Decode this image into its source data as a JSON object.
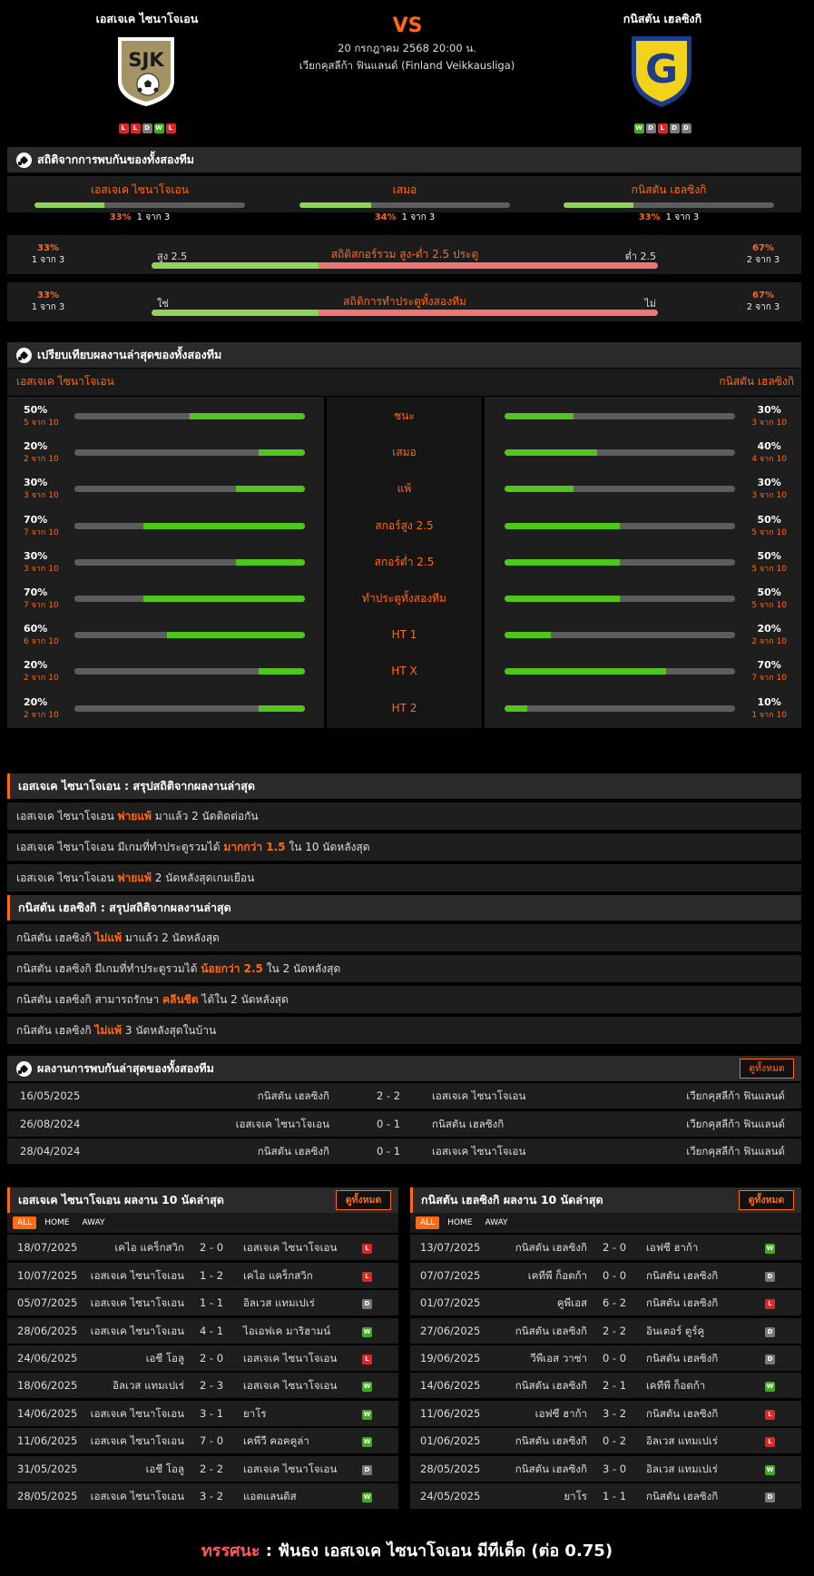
{
  "header": {
    "vs": "VS",
    "home": {
      "name": "เอสเจเค ไซนาโจเอน",
      "logo_text": "SJK",
      "form": [
        "L",
        "L",
        "D",
        "W",
        "L"
      ]
    },
    "away": {
      "name": "กนิสตัน เฮลซิงกิ",
      "logo_text": "G",
      "form": [
        "W",
        "D",
        "L",
        "D",
        "D"
      ]
    },
    "datetime": "20 กรกฎาคม 2568 20:00 น.",
    "league": "เวียกคุสลีก้า ฟินแลนด์ (Finland Veikkausliga)"
  },
  "h2h_stats": {
    "title": "สถิติจากการพบกันของทั้งสองทีม",
    "cols": [
      {
        "label": "เอสเจเค ไซนาโจเอน",
        "pct": "33%",
        "sub": "1 จาก 3",
        "frac": 0.33
      },
      {
        "label": "เสมอ",
        "pct": "34%",
        "sub": "1 จาก 3",
        "frac": 0.34
      },
      {
        "label": "กนิสตัน เฮลซิงกิ",
        "pct": "33%",
        "sub": "1 จาก 3",
        "frac": 0.33
      }
    ],
    "ou": {
      "title": "สถิติสกอร์รวม สูง-ต่ำ 2.5 ประตู",
      "left_label": "สูง 2.5",
      "right_label": "ต่ำ 2.5",
      "left_pct": "33%",
      "left_sub": "1 จาก 3",
      "right_pct": "67%",
      "right_sub": "2 จาก 3",
      "frac": 0.33
    },
    "btts": {
      "title": "สถิติการทำประตูทั้งสองทีม",
      "left_label": "ใช่",
      "right_label": "ไม่",
      "left_pct": "33%",
      "left_sub": "1 จาก 3",
      "right_pct": "67%",
      "right_sub": "2 จาก 3",
      "frac": 0.33
    }
  },
  "compare": {
    "title": "เปรียบเทียบผลงานล่าสุดของทั้งสองทีม",
    "home": "เอสเจเค ไซนาโจเอน",
    "away": "กนิสตัน เฮลซิงกิ",
    "rows": [
      {
        "label": "ชนะ",
        "hp": "50%",
        "hs": "5 จาก 10",
        "hf": 0.5,
        "ap": "30%",
        "as": "3 จาก 10",
        "af": 0.3
      },
      {
        "label": "เสมอ",
        "hp": "20%",
        "hs": "2 จาก 10",
        "hf": 0.2,
        "ap": "40%",
        "as": "4 จาก 10",
        "af": 0.4
      },
      {
        "label": "แพ้",
        "hp": "30%",
        "hs": "3 จาก 10",
        "hf": 0.3,
        "ap": "30%",
        "as": "3 จาก 10",
        "af": 0.3
      },
      {
        "label": "สกอร์สูง 2.5",
        "hp": "70%",
        "hs": "7 จาก 10",
        "hf": 0.7,
        "ap": "50%",
        "as": "5 จาก 10",
        "af": 0.5
      },
      {
        "label": "สกอร์ต่ำ 2.5",
        "hp": "30%",
        "hs": "3 จาก 10",
        "hf": 0.3,
        "ap": "50%",
        "as": "5 จาก 10",
        "af": 0.5
      },
      {
        "label": "ทำประตูทั้งสองทีม",
        "hp": "70%",
        "hs": "7 จาก 10",
        "hf": 0.7,
        "ap": "50%",
        "as": "5 จาก 10",
        "af": 0.5
      },
      {
        "label": "HT 1",
        "hp": "60%",
        "hs": "6 จาก 10",
        "hf": 0.6,
        "ap": "20%",
        "as": "2 จาก 10",
        "af": 0.2
      },
      {
        "label": "HT X",
        "hp": "20%",
        "hs": "2 จาก 10",
        "hf": 0.2,
        "ap": "70%",
        "as": "7 จาก 10",
        "af": 0.7
      },
      {
        "label": "HT 2",
        "hp": "20%",
        "hs": "2 จาก 10",
        "hf": 0.2,
        "ap": "10%",
        "as": "1 จาก 10",
        "af": 0.1
      }
    ]
  },
  "summary_home": {
    "title": "เอสเจเค ไซนาโจเอน : สรุปสถิติจากผลงานล่าสุด",
    "rows": [
      [
        "เอสเจเค ไซนาโจเอน ",
        "พ่ายแพ้",
        " มาแล้ว 2 นัดติดต่อกัน"
      ],
      [
        "เอสเจเค ไซนาโจเอน  มีเกมที่ทำประตูรวมได้ ",
        "มากกว่า 1.5",
        " ใน 10 นัดหลังสุด"
      ],
      [
        "เอสเจเค ไซนาโจเอน ",
        "พ่ายแพ้",
        " 2  นัดหลังสุดเกมเยือน"
      ]
    ]
  },
  "summary_away": {
    "title": "กนิสตัน เฮลซิงกิ : สรุปสถิติจากผลงานล่าสุด",
    "rows": [
      [
        "กนิสตัน เฮลซิงกิ ",
        "ไม่แพ้",
        " มาแล้ว 2 นัดหลังสุด"
      ],
      [
        "กนิสตัน เฮลซิงกิ  มีเกมที่ทำประตูรวมได้ ",
        "น้อยกว่า 2.5",
        " ใน 2 นัดหลังสุด"
      ],
      [
        "กนิสตัน เฮลซิงกิ  สามารถรักษา ",
        "คลีนชีต",
        " ได้ใน 2 นัดหลังสุด"
      ],
      [
        "กนิสตัน เฮลซิงกิ ",
        "ไม่แพ้",
        " 3  นัดหลังสุดในบ้าน"
      ]
    ]
  },
  "h2h_results": {
    "title": "ผลงานการพบกันล่าสุดของทั้งสองทีม",
    "view_all": "ดูทั้งหมด",
    "rows": [
      {
        "date": "16/05/2025",
        "home": "กนิสตัน เฮลซิงกิ",
        "score": "2 - 2",
        "away": "เอสเจเค ไซนาโจเอน",
        "league": "เวียกคุสลีก้า ฟินแลนด์"
      },
      {
        "date": "26/08/2024",
        "home": "เอสเจเค ไซนาโจเอน",
        "score": "0 - 1",
        "away": "กนิสตัน เฮลซิงกิ",
        "league": "เวียกคุสลีก้า ฟินแลนด์"
      },
      {
        "date": "28/04/2024",
        "home": "กนิสตัน เฮลซิงกิ",
        "score": "0 - 1",
        "away": "เอสเจเค ไซนาโจเอน",
        "league": "เวียกคุสลีก้า ฟินแลนด์"
      }
    ]
  },
  "last10_home": {
    "title": "เอสเจเค ไซนาโจเอน ผลงาน 10 นัดล่าสุด",
    "view_all": "ดูทั้งหมด",
    "tabs": [
      "ALL",
      "HOME",
      "AWAY"
    ],
    "rows": [
      {
        "date": "18/07/2025",
        "home": "เคไอ แคร็กสวิก",
        "score": "2 - 0",
        "away": "เอสเจเค ไซนาโจเอน",
        "res": "L"
      },
      {
        "date": "10/07/2025",
        "home": "เอสเจเค ไซนาโจเอน",
        "score": "1 - 2",
        "away": "เคไอ แคร็กสวิก",
        "res": "L"
      },
      {
        "date": "05/07/2025",
        "home": "เอสเจเค ไซนาโจเอน",
        "score": "1 - 1",
        "away": "อิลเวส แทมเปเร่",
        "res": "D"
      },
      {
        "date": "28/06/2025",
        "home": "เอสเจเค ไซนาโจเอน",
        "score": "4 - 1",
        "away": "ไอเอฟเค มาริฮามน์",
        "res": "W"
      },
      {
        "date": "24/06/2025",
        "home": "เอชี โอลู",
        "score": "2 - 0",
        "away": "เอสเจเค ไซนาโจเอน",
        "res": "L"
      },
      {
        "date": "18/06/2025",
        "home": "อิลเวส แทมเปเร่",
        "score": "2 - 3",
        "away": "เอสเจเค ไซนาโจเอน",
        "res": "W"
      },
      {
        "date": "14/06/2025",
        "home": "เอสเจเค ไซนาโจเอน",
        "score": "3 - 1",
        "away": "ยาโร",
        "res": "W"
      },
      {
        "date": "11/06/2025",
        "home": "เอสเจเค ไซนาโจเอน",
        "score": "7 - 0",
        "away": "เคพีวี คอคคูล่า",
        "res": "W"
      },
      {
        "date": "31/05/2025",
        "home": "เอชี โอลู",
        "score": "2 - 2",
        "away": "เอสเจเค ไซนาโจเอน",
        "res": "D"
      },
      {
        "date": "28/05/2025",
        "home": "เอสเจเค ไซนาโจเอน",
        "score": "3 - 2",
        "away": "แอตแลนติส",
        "res": "W"
      }
    ]
  },
  "last10_away": {
    "title": "กนิสตัน เฮลซิงกิ ผลงาน 10 นัดล่าสุด",
    "view_all": "ดูทั้งหมด",
    "tabs": [
      "ALL",
      "HOME",
      "AWAY"
    ],
    "rows": [
      {
        "date": "13/07/2025",
        "home": "กนิสตัน เฮลซิงกิ",
        "score": "2 - 0",
        "away": "เอฟซี ฮาก้า",
        "res": "W"
      },
      {
        "date": "07/07/2025",
        "home": "เคทีพี ก็อตก้า",
        "score": "0 - 0",
        "away": "กนิสตัน เฮลซิงกิ",
        "res": "D"
      },
      {
        "date": "01/07/2025",
        "home": "คูพีเอส",
        "score": "6 - 2",
        "away": "กนิสตัน เฮลซิงกิ",
        "res": "L"
      },
      {
        "date": "27/06/2025",
        "home": "กนิสตัน เฮลซิงกิ",
        "score": "2 - 2",
        "away": "อินเตอร์ ตูร์คู",
        "res": "D"
      },
      {
        "date": "19/06/2025",
        "home": "วีพีเอส วาซ่า",
        "score": "0 - 0",
        "away": "กนิสตัน เฮลซิงกิ",
        "res": "D"
      },
      {
        "date": "14/06/2025",
        "home": "กนิสตัน เฮลซิงกิ",
        "score": "2 - 1",
        "away": "เคทีพี ก็อตก้า",
        "res": "W"
      },
      {
        "date": "11/06/2025",
        "home": "เอฟซี ฮาก้า",
        "score": "3 - 2",
        "away": "กนิสตัน เฮลซิงกิ",
        "res": "L"
      },
      {
        "date": "01/06/2025",
        "home": "กนิสตัน เฮลซิงกิ",
        "score": "0 - 2",
        "away": "อิลเวส แทมเปเร่",
        "res": "L"
      },
      {
        "date": "28/05/2025",
        "home": "กนิสตัน เฮลซิงกิ",
        "score": "3 - 0",
        "away": "อิลเวส แทมเปเร่",
        "res": "W"
      },
      {
        "date": "24/05/2025",
        "home": "ยาโร",
        "score": "1 - 1",
        "away": "กนิสตัน เฮลซิงกิ",
        "res": "D"
      }
    ]
  },
  "verdict": {
    "label": "ทรรศนะ",
    "sep": " : ",
    "text": " ฟันธง เอสเจเค ไซนาโจเอน มีทีเด็ด (ต่อ 0.75)"
  },
  "colors": {
    "accent": "#ff6a13",
    "win": "#3eac1c",
    "loss": "#e02525",
    "draw": "#7a7a7a",
    "bar_green": "#4fc51e",
    "bar_red": "#f07575"
  }
}
